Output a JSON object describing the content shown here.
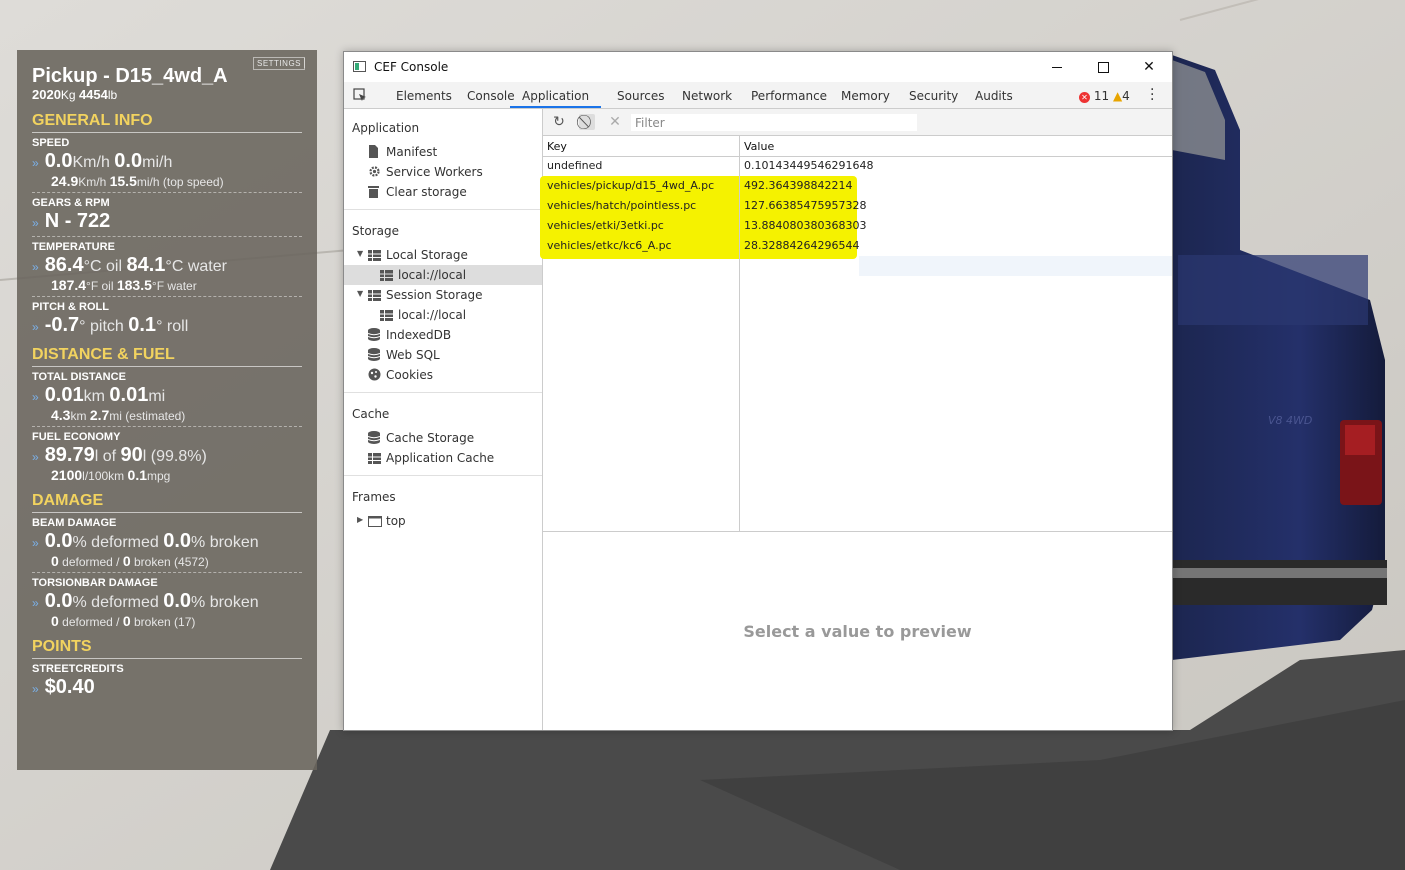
{
  "hud": {
    "settings": "SETTINGS",
    "vehicle_name": "Pickup - D15_4wd_A",
    "mass_kg": "2020",
    "mass_kg_unit": "Kg",
    "mass_lb": "4454",
    "mass_lb_unit": "lb",
    "sections": {
      "general": "GENERAL INFO",
      "distance": "DISTANCE & FUEL",
      "damage": "DAMAGE",
      "points": "POINTS"
    },
    "speed": {
      "label": "SPEED",
      "kmh": "0.0",
      "kmh_unit": "Km/h",
      "mih": "0.0",
      "mih_unit": "mi/h",
      "top_kmh": "24.9",
      "top_kmh_unit": "Km/h",
      "top_mih": "15.5",
      "top_mih_unit": "mi/h (top speed)"
    },
    "gears": {
      "label": "GEARS & RPM",
      "value": "N - 722"
    },
    "temperature": {
      "label": "TEMPERATURE",
      "oil_c": "86.4",
      "oil_c_unit": "°C oil",
      "water_c": "84.1",
      "water_c_unit": "°C water",
      "oil_f": "187.4",
      "oil_f_unit": "°F oil",
      "water_f": "183.5",
      "water_f_unit": "°F water"
    },
    "pitch": {
      "label": "PITCH & ROLL",
      "pitch": "-0.7",
      "pitch_unit": "° pitch",
      "roll": "0.1",
      "roll_unit": "° roll"
    },
    "total_distance": {
      "label": "TOTAL DISTANCE",
      "km": "0.01",
      "km_unit": "km",
      "mi": "0.01",
      "mi_unit": "mi",
      "est_km": "4.3",
      "est_km_unit": "km",
      "est_mi": "2.7",
      "est_mi_unit": "mi (estimated)"
    },
    "fuel": {
      "label": "FUEL ECONOMY",
      "level": "89.79",
      "level_unit": "l of",
      "capacity": "90",
      "capacity_unit": "l (99.8%)",
      "consumption": "2100",
      "consumption_unit": "l/100km",
      "mpg": "0.1",
      "mpg_unit": "mpg"
    },
    "beam_damage": {
      "label": "BEAM DAMAGE",
      "deformed_pct": "0.0",
      "deformed_pct_unit": "% deformed",
      "broken_pct": "0.0",
      "broken_pct_unit": "% broken",
      "deformed": "0",
      "deformed_unit": "deformed /",
      "broken": "0",
      "broken_unit": "broken (4572)"
    },
    "torsion_damage": {
      "label": "TORSIONBAR DAMAGE",
      "deformed_pct": "0.0",
      "deformed_pct_unit": "% deformed",
      "broken_pct": "0.0",
      "broken_pct_unit": "% broken",
      "deformed": "0",
      "deformed_unit": "deformed /",
      "broken": "0",
      "broken_unit": "broken (17)"
    },
    "streetcredits": {
      "label": "STREETCREDITS",
      "value": "$0.40"
    }
  },
  "window": {
    "title": "CEF Console",
    "tabs": [
      "Elements",
      "Console",
      "Application",
      "Sources",
      "Network",
      "Performance",
      "Memory",
      "Security",
      "Audits"
    ],
    "active_tab": "Application",
    "errors": "11",
    "warnings": "4",
    "error_color": "#e33333",
    "warning_color": "#e8a500"
  },
  "sidebar": {
    "application_header": "Application",
    "application_items": [
      "Manifest",
      "Service Workers",
      "Clear storage"
    ],
    "storage_header": "Storage",
    "local_storage": "Local Storage",
    "local_storage_child": "local://local",
    "session_storage": "Session Storage",
    "session_storage_child": "local://local",
    "indexeddb": "IndexedDB",
    "websql": "Web SQL",
    "cookies": "Cookies",
    "cache_header": "Cache",
    "cache_storage": "Cache Storage",
    "application_cache": "Application Cache",
    "frames_header": "Frames",
    "frames_top": "top"
  },
  "storage_table": {
    "filter_placeholder": "Filter",
    "columns": {
      "key": "Key",
      "value": "Value"
    },
    "rows": [
      {
        "key": "undefined",
        "value": "0.10143449546291648"
      },
      {
        "key": "vehicles/pickup/d15_4wd_A.pc",
        "value": "492.364398842214"
      },
      {
        "key": "vehicles/hatch/pointless.pc",
        "value": "127.66385475957328"
      },
      {
        "key": "vehicles/etki/3etki.pc",
        "value": "13.884080380368303"
      },
      {
        "key": "vehicles/etkc/kc6_A.pc",
        "value": "28.32884264296544"
      }
    ],
    "highlight_color": "#f5f200"
  },
  "preview": {
    "message": "Select a value to preview"
  }
}
